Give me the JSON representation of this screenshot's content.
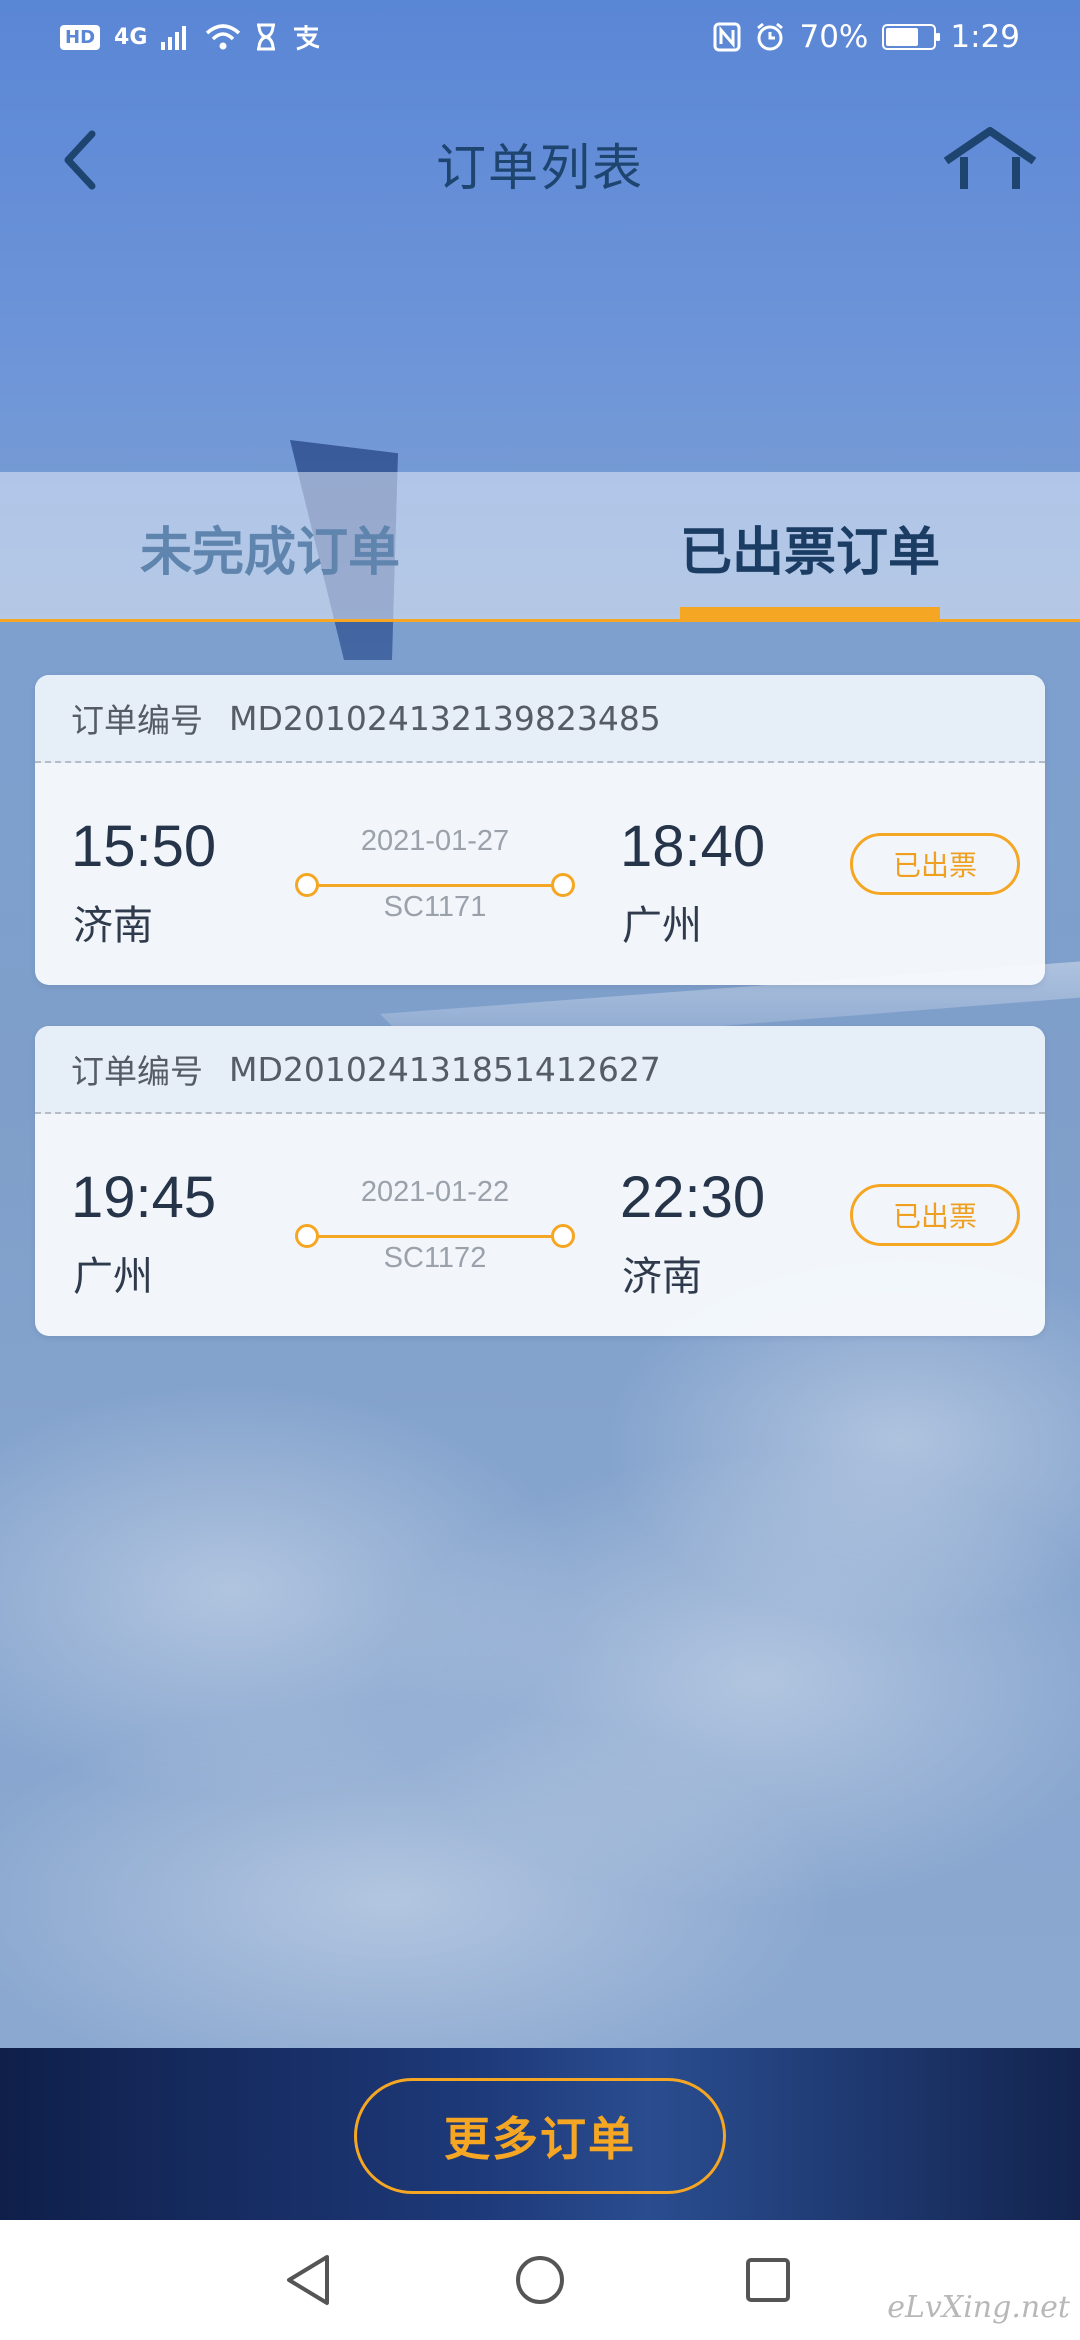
{
  "status_bar": {
    "left_hd": "HD",
    "network": "4G",
    "battery_percent": "70%",
    "battery_level": 0.7,
    "time": "1:29"
  },
  "header": {
    "title": "订单列表",
    "back_icon": "chevron-left-icon",
    "home_icon": "home-icon"
  },
  "tabs": [
    {
      "label": "未完成订单",
      "active": false
    },
    {
      "label": "已出票订单",
      "active": true
    }
  ],
  "orders": [
    {
      "order_label": "订单编号",
      "order_number": "MD201024132139823485",
      "dep_time": "15:50",
      "dep_city": "济南",
      "date": "2021-01-27",
      "flight": "SC1171",
      "arr_time": "18:40",
      "arr_city": "广州",
      "status": "已出票"
    },
    {
      "order_label": "订单编号",
      "order_number": "MD201024131851412627",
      "dep_time": "19:45",
      "dep_city": "广州",
      "date": "2021-01-22",
      "flight": "SC1172",
      "arr_time": "22:30",
      "arr_city": "济南",
      "status": "已出票"
    }
  ],
  "footer": {
    "more_label": "更多订单"
  },
  "system_nav": {
    "back": "back-triangle-icon",
    "home": "home-circle-icon",
    "recents": "recents-square-icon"
  },
  "watermark": "eLvXing.net",
  "colors": {
    "accent": "#f5a623",
    "title": "#1e4470",
    "tab_active": "#1b3d64",
    "tab_inactive": "#5f85ae"
  }
}
